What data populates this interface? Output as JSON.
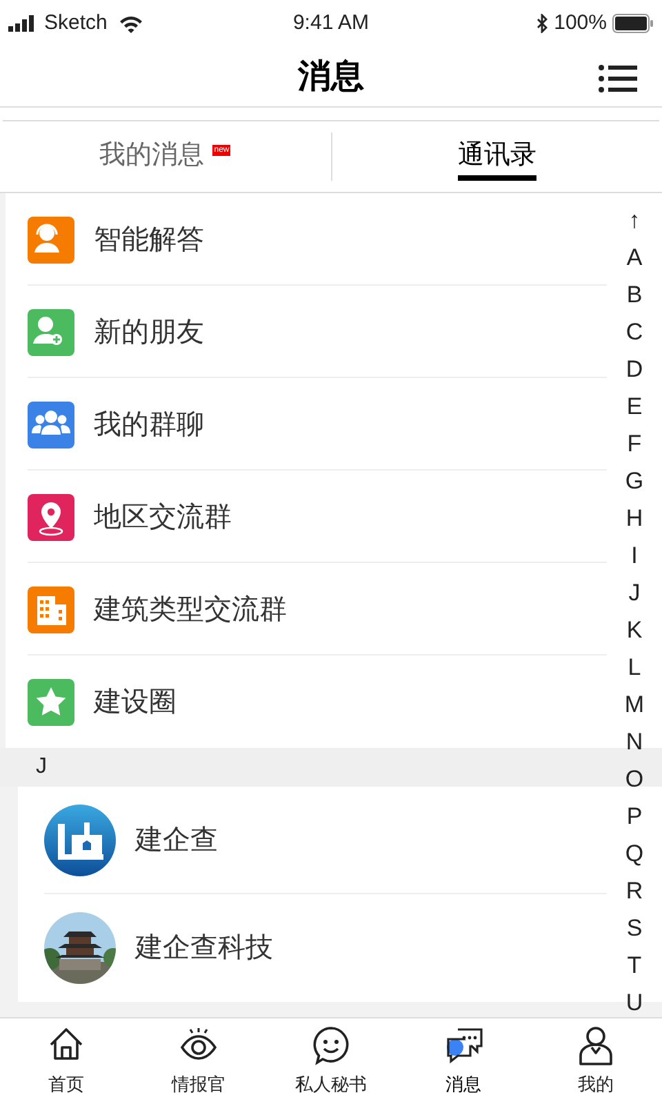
{
  "status_bar": {
    "carrier": "Sketch",
    "time": "9:41 AM",
    "battery": "100%"
  },
  "header": {
    "title": "消息"
  },
  "tabs": [
    {
      "label": "我的消息",
      "badge": "new",
      "selected": false
    },
    {
      "label": "通讯录",
      "selected": true
    }
  ],
  "entries": [
    {
      "label": "智能解答",
      "kind": "headset",
      "color": "#f57c00"
    },
    {
      "label": "新的朋友",
      "kind": "add-person",
      "color": "#4cbb5f"
    },
    {
      "label": "我的群聊",
      "kind": "group",
      "color": "#3b82e6"
    },
    {
      "label": "地区交流群",
      "kind": "pin",
      "color": "#e0245e"
    },
    {
      "label": "建筑类型交流群",
      "kind": "building",
      "color": "#f57c00"
    },
    {
      "label": "建设圈",
      "kind": "star",
      "color": "#4cbb5f"
    }
  ],
  "sections": [
    {
      "letter": "J",
      "contacts": [
        {
          "name": "建企查",
          "kind": "logo"
        },
        {
          "name": "建企查科技",
          "kind": "picture"
        }
      ]
    }
  ],
  "index": [
    "↑",
    "A",
    "B",
    "C",
    "D",
    "E",
    "F",
    "G",
    "H",
    "I",
    "J",
    "K",
    "L",
    "M",
    "N",
    "O",
    "P",
    "Q",
    "R",
    "S",
    "T",
    "U"
  ],
  "tab_bar": [
    {
      "label": "首页",
      "kind": "home",
      "selected": false
    },
    {
      "label": "情报官",
      "kind": "eye",
      "selected": false
    },
    {
      "label": "私人秘书",
      "kind": "smile",
      "selected": false
    },
    {
      "label": "消息",
      "kind": "chat",
      "selected": true
    },
    {
      "label": "我的",
      "kind": "person",
      "selected": false
    }
  ]
}
